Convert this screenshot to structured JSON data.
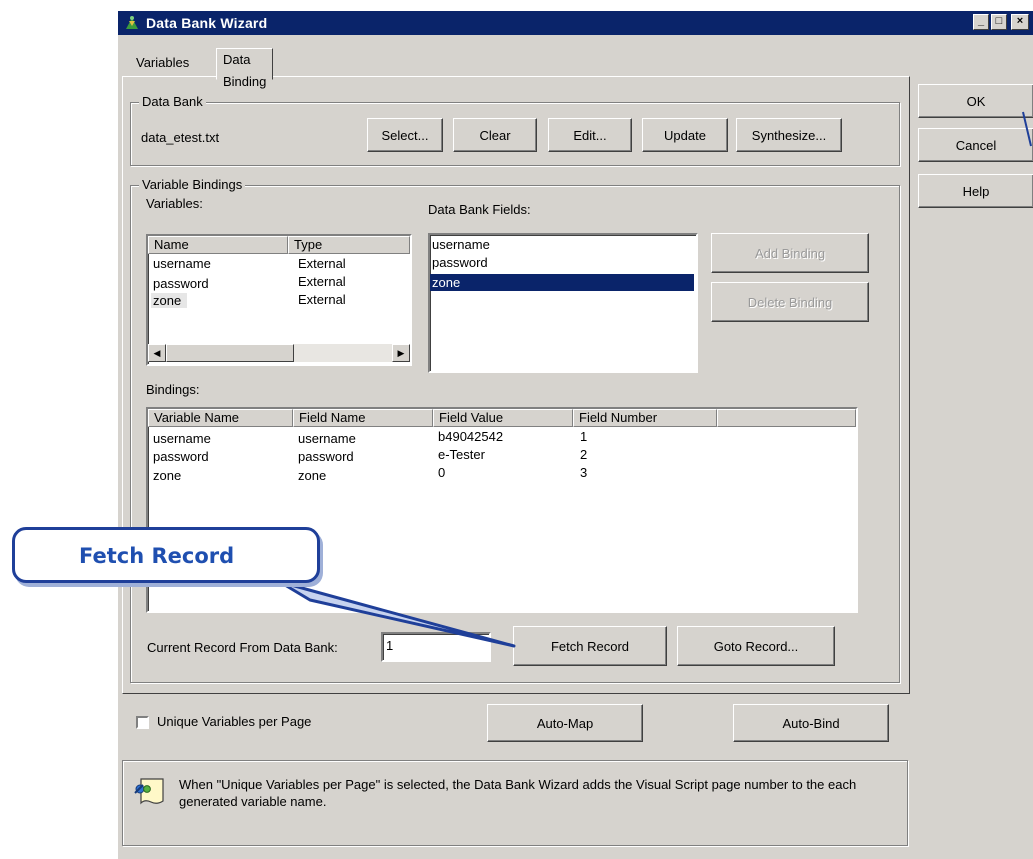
{
  "window": {
    "title": "Data Bank Wizard",
    "controls": {
      "minimize": "_",
      "maximize": "□",
      "close": "×"
    }
  },
  "tabs": [
    {
      "label": "Variables",
      "active": false
    },
    {
      "label": "Data Binding",
      "active": true
    }
  ],
  "data_bank": {
    "group_label": "Data Bank",
    "file": "data_etest.txt",
    "buttons": {
      "select": "Select...",
      "clear": "Clear",
      "edit": "Edit...",
      "update": "Update",
      "synthesize": "Synthesize..."
    }
  },
  "variable_bindings": {
    "group_label": "Variable Bindings",
    "variables_label": "Variables:",
    "fields_label": "Data Bank Fields:",
    "variables_columns": [
      "Name",
      "Type"
    ],
    "variables_rows": [
      {
        "name": "username",
        "type": "External"
      },
      {
        "name": "password",
        "type": "External"
      },
      {
        "name": "zone",
        "type": "External"
      }
    ],
    "fields": [
      "username",
      "password",
      "zone"
    ],
    "selected_field": "zone",
    "add_binding": "Add Binding",
    "delete_binding": "Delete Binding",
    "bindings_label": "Bindings:",
    "bindings_columns": [
      "Variable Name",
      "Field Name",
      "Field Value",
      "Field Number"
    ],
    "bindings_rows": [
      {
        "variable": "username",
        "field": "username",
        "value": "b49042542",
        "number": "1"
      },
      {
        "variable": "password",
        "field": "password",
        "value": "e-Tester",
        "number": "2"
      },
      {
        "variable": "zone",
        "field": "zone",
        "value": "0",
        "number": "3"
      }
    ],
    "current_record_label": "Current Record From Data Bank:",
    "current_record_value": "1",
    "fetch_record": "Fetch Record",
    "goto_record": "Goto Record..."
  },
  "side_buttons": {
    "ok": "OK",
    "cancel": "Cancel",
    "help": "Help"
  },
  "footer": {
    "unique_checkbox_label": "Unique Variables per Page",
    "unique_checked": false,
    "auto_map": "Auto-Map",
    "auto_bind": "Auto-Bind",
    "info_text": "When \"Unique Variables per Page\" is selected, the Data Bank Wizard adds the Visual Script page number to the each generated variable name."
  },
  "annotation": {
    "callout_text": "Fetch Record",
    "color": "#1f3f99"
  },
  "colors": {
    "face": "#d6d3ce",
    "titlebar": "#0a246a",
    "selection": "#0a246a"
  }
}
